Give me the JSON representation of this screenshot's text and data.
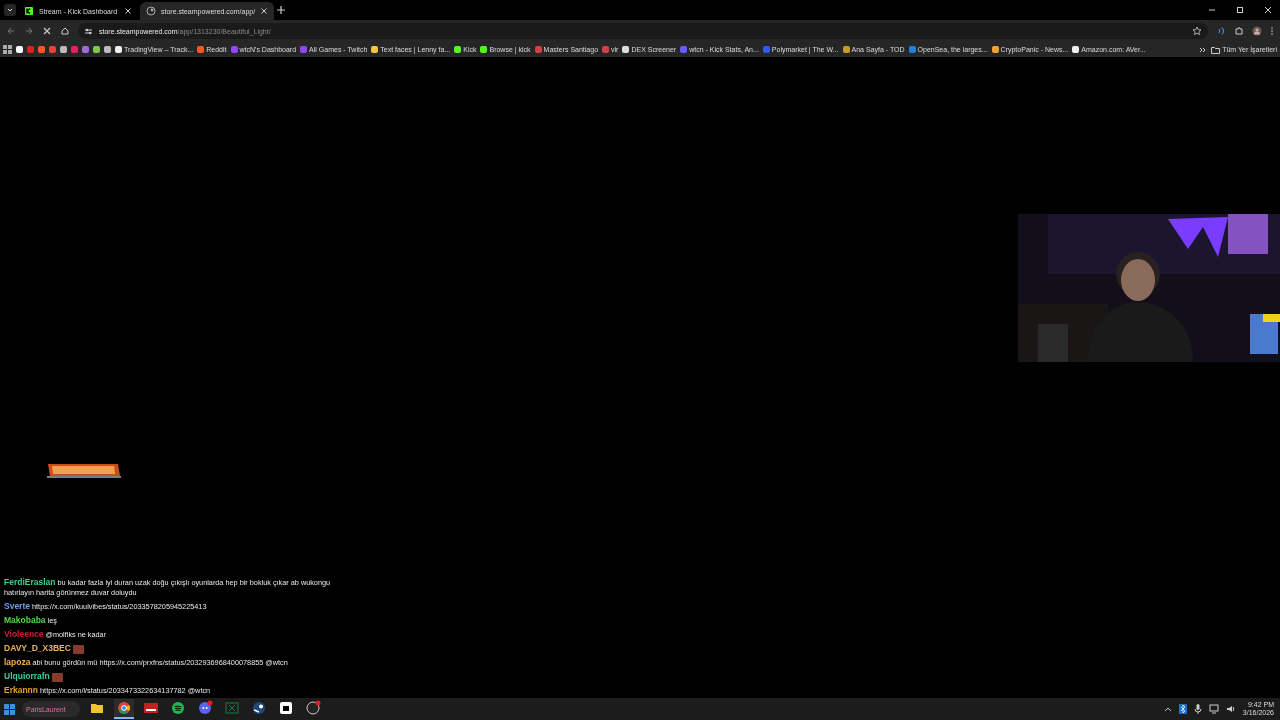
{
  "tabs": [
    {
      "title": "Stream - Kick Dashboard",
      "kind": "kick",
      "selected": false
    },
    {
      "title": "store.steampowered.com/app/",
      "kind": "steam",
      "selected": true
    }
  ],
  "address_bar": {
    "host": "store.steampowered.com",
    "path": "/app/1313230/Beautiful_Light/",
    "loading": true
  },
  "bookmarks": [
    {
      "color": "#ffffff"
    },
    {
      "color": "#e02020"
    },
    {
      "color": "#ff5722"
    },
    {
      "color": "#ea4335"
    },
    {
      "color": "#bbbbbb"
    },
    {
      "color": "#e0245e"
    },
    {
      "color": "#a16ad8"
    },
    {
      "color": "#7ec850"
    },
    {
      "color": "#bbbbbb"
    },
    {
      "label": "TradingView – Track...",
      "color": "#eeeeee"
    },
    {
      "label": "Reddit",
      "color": "#ff5722"
    },
    {
      "label": "wtcN's Dashboard",
      "color": "#9146ff"
    },
    {
      "label": "All Games - Twitch",
      "color": "#9146ff"
    },
    {
      "label": "Text faces | Lenny fa...",
      "color": "#f5c542"
    },
    {
      "label": "Kick",
      "color": "#53fc18"
    },
    {
      "label": "Browse | kick",
      "color": "#53fc18"
    },
    {
      "label": "Masters Santiago",
      "color": "#d4404a"
    },
    {
      "label": "vlr",
      "color": "#d4404a"
    },
    {
      "label": "DEX Screener",
      "color": "#dddddd"
    },
    {
      "label": "wtcn - Kick Stats, An...",
      "color": "#6a5cff"
    },
    {
      "label": "Polymarket | The W...",
      "color": "#2d5bff"
    },
    {
      "label": "Ana Sayfa - TOD",
      "color": "#c89a2a"
    },
    {
      "label": "OpenSea, the larges...",
      "color": "#2081e2"
    },
    {
      "label": "CryptoPanic - News...",
      "color": "#f0a030"
    },
    {
      "label": "Amazon.com: AVer...",
      "color": "#eeeeee"
    }
  ],
  "all_bookmarks": "Tüm Yer İşaretleri",
  "chat": [
    {
      "user": "FerdiEraslan",
      "color": "#3fd08a",
      "text": "bu kadar fazla iyi duran uzak doğu çıkışlı oyunlarda hep bir bokluk çıkar ab wukongu hatırlayın harita görünmez duvar doluydu",
      "emote": false
    },
    {
      "user": "Sverte",
      "color": "#6f9fe8",
      "text": "https://x.com/kuulvibes/status/2033578205945225413",
      "emote": false
    },
    {
      "user": "Makobaba",
      "color": "#56d84a",
      "text": "leş",
      "emote": false
    },
    {
      "user": "Violeence",
      "color": "#c8203c",
      "text": "@molfiks ne kadar",
      "emote": false
    },
    {
      "user": "DAVY_D_X3BEC",
      "color": "#e8b35a",
      "emote": true
    },
    {
      "user": "lapoza",
      "color": "#f0b040",
      "text": "abi bunu gördün mü https://x.com/prxfns/status/2032936968400078855 @wtcn",
      "emote": false
    },
    {
      "user": "Ulquiorrafn",
      "color": "#3fd0a0",
      "emote": true
    },
    {
      "user": "Erkannn",
      "color": "#e0a030",
      "text": "https://x.com/i/status/2033473322634137782 @wtcn",
      "emote": false
    }
  ],
  "taskbar": {
    "search": "ParisLaurent",
    "apps": [
      {
        "kind": "folder",
        "selected": false
      },
      {
        "kind": "chrome",
        "selected": true
      },
      {
        "kind": "video",
        "selected": false
      },
      {
        "kind": "spotify",
        "selected": false
      },
      {
        "kind": "discord",
        "selected": false
      },
      {
        "kind": "sheet",
        "selected": false
      },
      {
        "kind": "steam",
        "selected": false
      },
      {
        "kind": "box",
        "selected": false
      },
      {
        "kind": "obs",
        "selected": false
      }
    ],
    "time": "9:42 PM",
    "date": "3/16/2026"
  }
}
